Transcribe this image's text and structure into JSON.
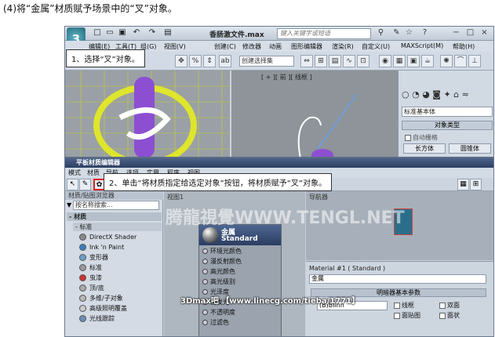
{
  "heading": "(4)将“金属”材质赋予场景中的“叉”对象。",
  "app": {
    "logo_glyph": "3",
    "doc_title": "香肠激文件.max",
    "search_placeholder": "键入关键字或短语",
    "menus": [
      "编辑(E)",
      "工具(T)",
      "组(G)",
      "视图(V)",
      "创建(C)",
      "修改器",
      "动画",
      "图形编辑器",
      "渲染(R)",
      "自定义(U)",
      "MAXScript(M)",
      "帮助(H)"
    ],
    "selection_set": "创建选择集",
    "viewport_label": "[ + ][ 前 ][ 线框 ]"
  },
  "command_panel": {
    "category": "标准基本体",
    "rollout": "对象类型",
    "autogrid": "自动栅格",
    "buttons": [
      "长方体",
      "圆锥体"
    ]
  },
  "material_editor": {
    "title": "平板材质编辑器",
    "menus": [
      "模式",
      "材质",
      "导航",
      "选项",
      "实用",
      "程序",
      "视图"
    ],
    "browser_title": "材质/贴图浏览器",
    "browser_search": "按名称搜索...",
    "group_material": "- 材质",
    "subgroup_standard": "- 标准",
    "materials": [
      "DirectX Shader",
      "Ink 'n Paint",
      "变形器",
      "标准",
      "虫漆",
      "顶/底",
      "多维/子对象",
      "高级照明覆盖",
      "光线跟踪"
    ],
    "view_label": "视图1",
    "node": {
      "name": "金属",
      "type": "Standard",
      "slots": [
        "环境光颜色",
        "漫反射颜色",
        "高光颜色",
        "高光级别",
        "光泽度",
        "自发光",
        "不透明度",
        "过滤色"
      ]
    },
    "navigator_label": "导航器",
    "params": {
      "header": "Material #1 ( Standard )",
      "name": "金属",
      "rollout": "明暗器基本参数",
      "shader": "(B)Blinn",
      "checkboxes": [
        "线框",
        "双面",
        "面贴图",
        "面状"
      ]
    }
  },
  "callouts": {
    "step1": "1、选择“叉”对象。",
    "step2": "2、单击“将材质指定给选定对象”按钮，将材质赋予“叉”对象。"
  },
  "watermarks": {
    "center": "腾龍視覺WWW.TENGL.NET",
    "footer": "3Dmax吧 【www.linecg.com/tieba/1771】"
  }
}
